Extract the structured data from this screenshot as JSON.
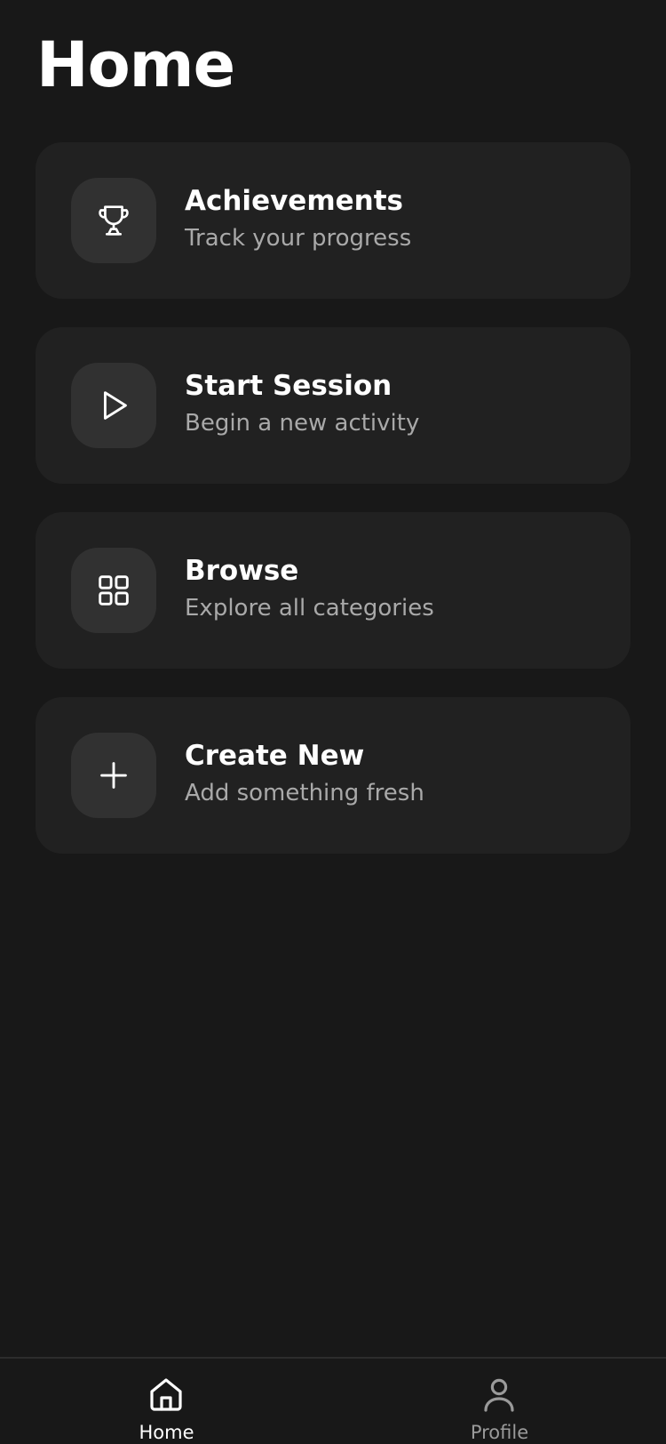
{
  "header": {
    "title": "Home"
  },
  "menu": {
    "items": [
      {
        "title": "Achievements",
        "subtitle": "Track your progress",
        "icon": "trophy-icon"
      },
      {
        "title": "Start Session",
        "subtitle": "Begin a new activity",
        "icon": "play-icon"
      },
      {
        "title": "Browse",
        "subtitle": "Explore all categories",
        "icon": "grid-icon"
      },
      {
        "title": "Create New",
        "subtitle": "Add something fresh",
        "icon": "plus-icon"
      }
    ]
  },
  "tabbar": {
    "tabs": [
      {
        "label": "Home",
        "icon": "home-icon",
        "active": true
      },
      {
        "label": "Profile",
        "icon": "user-icon",
        "active": false
      }
    ]
  },
  "colors": {
    "background": "#181818",
    "card": "#212121",
    "icon_tile": "#313131",
    "text_primary": "#ffffff",
    "text_secondary": "#a9a9a9",
    "tab_inactive": "#9a9a9a"
  }
}
